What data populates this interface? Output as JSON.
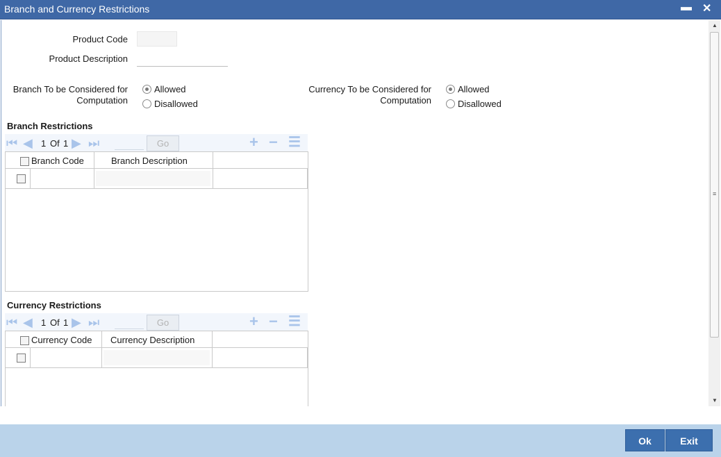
{
  "window": {
    "title": "Branch and Currency Restrictions",
    "minimize_glyph": "▬",
    "close_glyph": "✕"
  },
  "form": {
    "product_code_label": "Product Code",
    "product_code_value": "",
    "product_description_label": "Product Description",
    "product_description_value": "",
    "branch_consider_label_line1": "Branch To be Considered for",
    "branch_consider_label_line2": "Computation",
    "currency_consider_label_line1": "Currency To be Considered for",
    "currency_consider_label_line2": "Computation",
    "branch_radio_options": [
      "Allowed",
      "Disallowed"
    ],
    "branch_selected": "Allowed",
    "currency_radio_options": [
      "Allowed",
      "Disallowed"
    ],
    "currency_selected": "Allowed"
  },
  "branch_restrictions": {
    "title": "Branch Restrictions",
    "pager_current": "1",
    "pager_of": "Of",
    "pager_total": "1",
    "go_label": "Go",
    "columns": [
      "Branch Code",
      "Branch Description"
    ],
    "rows": [
      {
        "code": "",
        "description": ""
      }
    ]
  },
  "currency_restrictions": {
    "title": "Currency Restrictions",
    "pager_current": "1",
    "pager_of": "Of",
    "pager_total": "1",
    "go_label": "Go",
    "columns": [
      "Currency Code",
      "Currency Description"
    ],
    "rows": [
      {
        "code": "",
        "description": ""
      }
    ]
  },
  "footer": {
    "ok_label": "Ok",
    "exit_label": "Exit"
  },
  "colors": {
    "titlebar": "#3f68a6",
    "footer": "#bad3ea",
    "button": "#3c6fae",
    "nav_icons": "#a9c4ea"
  }
}
